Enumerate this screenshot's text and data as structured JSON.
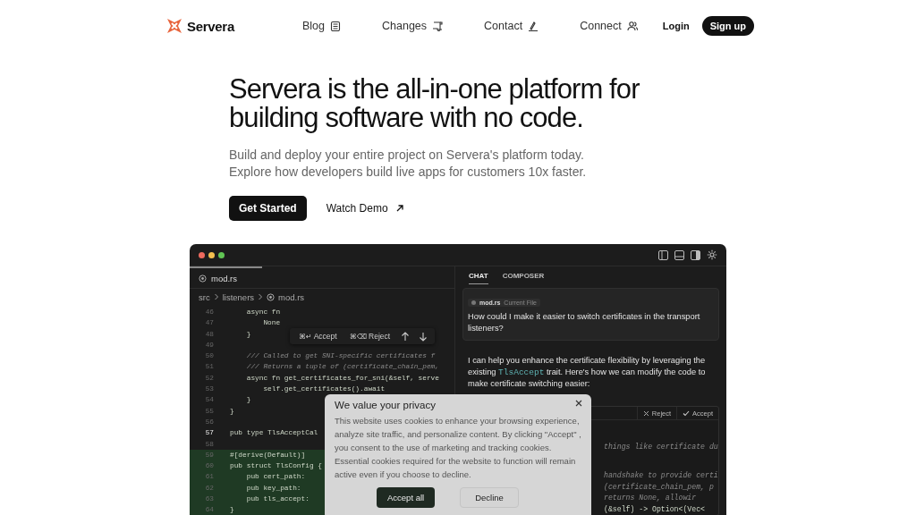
{
  "nav": {
    "brand": "Servera",
    "links": [
      {
        "label": "Blog"
      },
      {
        "label": "Changes"
      },
      {
        "label": "Contact"
      },
      {
        "label": "Connect"
      }
    ],
    "login": "Login",
    "signup": "Sign up"
  },
  "hero": {
    "title": "Servera is the all-in-one platform for building software with no code.",
    "subtitle": "Build and deploy your entire project on Servera's platform today. Explore how developers build live apps for customers 10x faster.",
    "primary": "Get Started",
    "secondary": "Watch Demo"
  },
  "editor": {
    "tab": "mod.rs",
    "breadcrumb": [
      "src",
      "listeners",
      "mod.rs"
    ],
    "toolbar": {
      "accept_key": "⌘↵",
      "accept": "Accept",
      "reject_key": "⌘⌫",
      "reject": "Reject"
    },
    "lines": [
      {
        "number": "46",
        "text": "    async fn",
        "kind": "code",
        "current": false,
        "added": false
      },
      {
        "number": "47",
        "text": "        None",
        "kind": "code",
        "current": false,
        "added": false
      },
      {
        "number": "48",
        "text": "    }",
        "kind": "code",
        "current": false,
        "added": false
      },
      {
        "number": "49",
        "current": false,
        "added": false
      },
      {
        "number": "50",
        "text": "    /// Called to get SNI-specific certificates f",
        "kind": "comment",
        "current": false,
        "added": false
      },
      {
        "number": "51",
        "text": "    /// Returns a tuple of (certificate_chain_pem,",
        "kind": "comment",
        "current": false,
        "added": false
      },
      {
        "number": "52",
        "text": "    async fn get_certificates_for_sni(&self, serve",
        "kind": "code",
        "current": false,
        "added": false
      },
      {
        "number": "53",
        "text": "        self.get_certificates().await",
        "kind": "code",
        "current": false,
        "added": false
      },
      {
        "number": "54",
        "text": "    }",
        "kind": "code",
        "current": false,
        "added": false
      },
      {
        "number": "55",
        "text": "}",
        "kind": "code",
        "current": false,
        "added": false
      },
      {
        "number": "56",
        "current": false,
        "added": false
      },
      {
        "number": "57",
        "text": "pub type TlsAcceptCal",
        "kind": "code",
        "current": true,
        "added": false
      },
      {
        "number": "58",
        "current": false,
        "added": false
      },
      {
        "number": "59",
        "text": "#[derive(Default)]",
        "kind": "code",
        "current": false,
        "added": true
      },
      {
        "number": "60",
        "text": "pub struct TlsConfig {",
        "kind": "code",
        "current": false,
        "added": true
      },
      {
        "number": "61",
        "text": "    pub cert_path:",
        "kind": "code",
        "current": false,
        "added": true
      },
      {
        "number": "62",
        "text": "    pub key_path:",
        "kind": "code",
        "current": false,
        "added": true
      },
      {
        "number": "63",
        "text": "    pub tls_accept:",
        "kind": "code",
        "current": false,
        "added": true
      },
      {
        "number": "64",
        "text": "}",
        "kind": "code",
        "current": false,
        "added": true
      }
    ]
  },
  "chat": {
    "tabs": [
      {
        "label": "CHAT",
        "selected": true
      },
      {
        "label": "COMPOSER",
        "selected": false
      }
    ],
    "question": {
      "file": "mod.rs",
      "file_note": "Current File",
      "text": "How could I make it easier to switch certificates in the transport listeners?"
    },
    "answer": {
      "before": "I can help you enhance the certificate flexibility by leveraging the existing",
      "code": "TlsAccept",
      "after": "trait. Here's how we can modify the code to make certificate switching easier:"
    },
    "code_card": {
      "reject": "Reject",
      "accept": "Accept",
      "lines": [
        {
          "text": "things like certificate du",
          "kind": "comment"
        },
        {
          "text": "handshake to provide certi",
          "kind": "comment"
        },
        {
          "text": "(certificate_chain_pem, p",
          "kind": "comment"
        },
        {
          "text": "returns None, allowir",
          "kind": "comment"
        },
        {
          "text": "(&self) -> Option<(Vec<",
          "kind": "code"
        }
      ]
    }
  },
  "cookie_banner": {
    "title": "We value your privacy",
    "text": "This website uses cookies to enhance your browsing experience, analyze site traffic, and personalize content. By clicking \"Accept\" , you consent to the use of marketing and tracking cookies. Essential cookies required for the website to function will remain active even if you choose to decline.",
    "accept": "Accept all",
    "decline": "Decline"
  }
}
